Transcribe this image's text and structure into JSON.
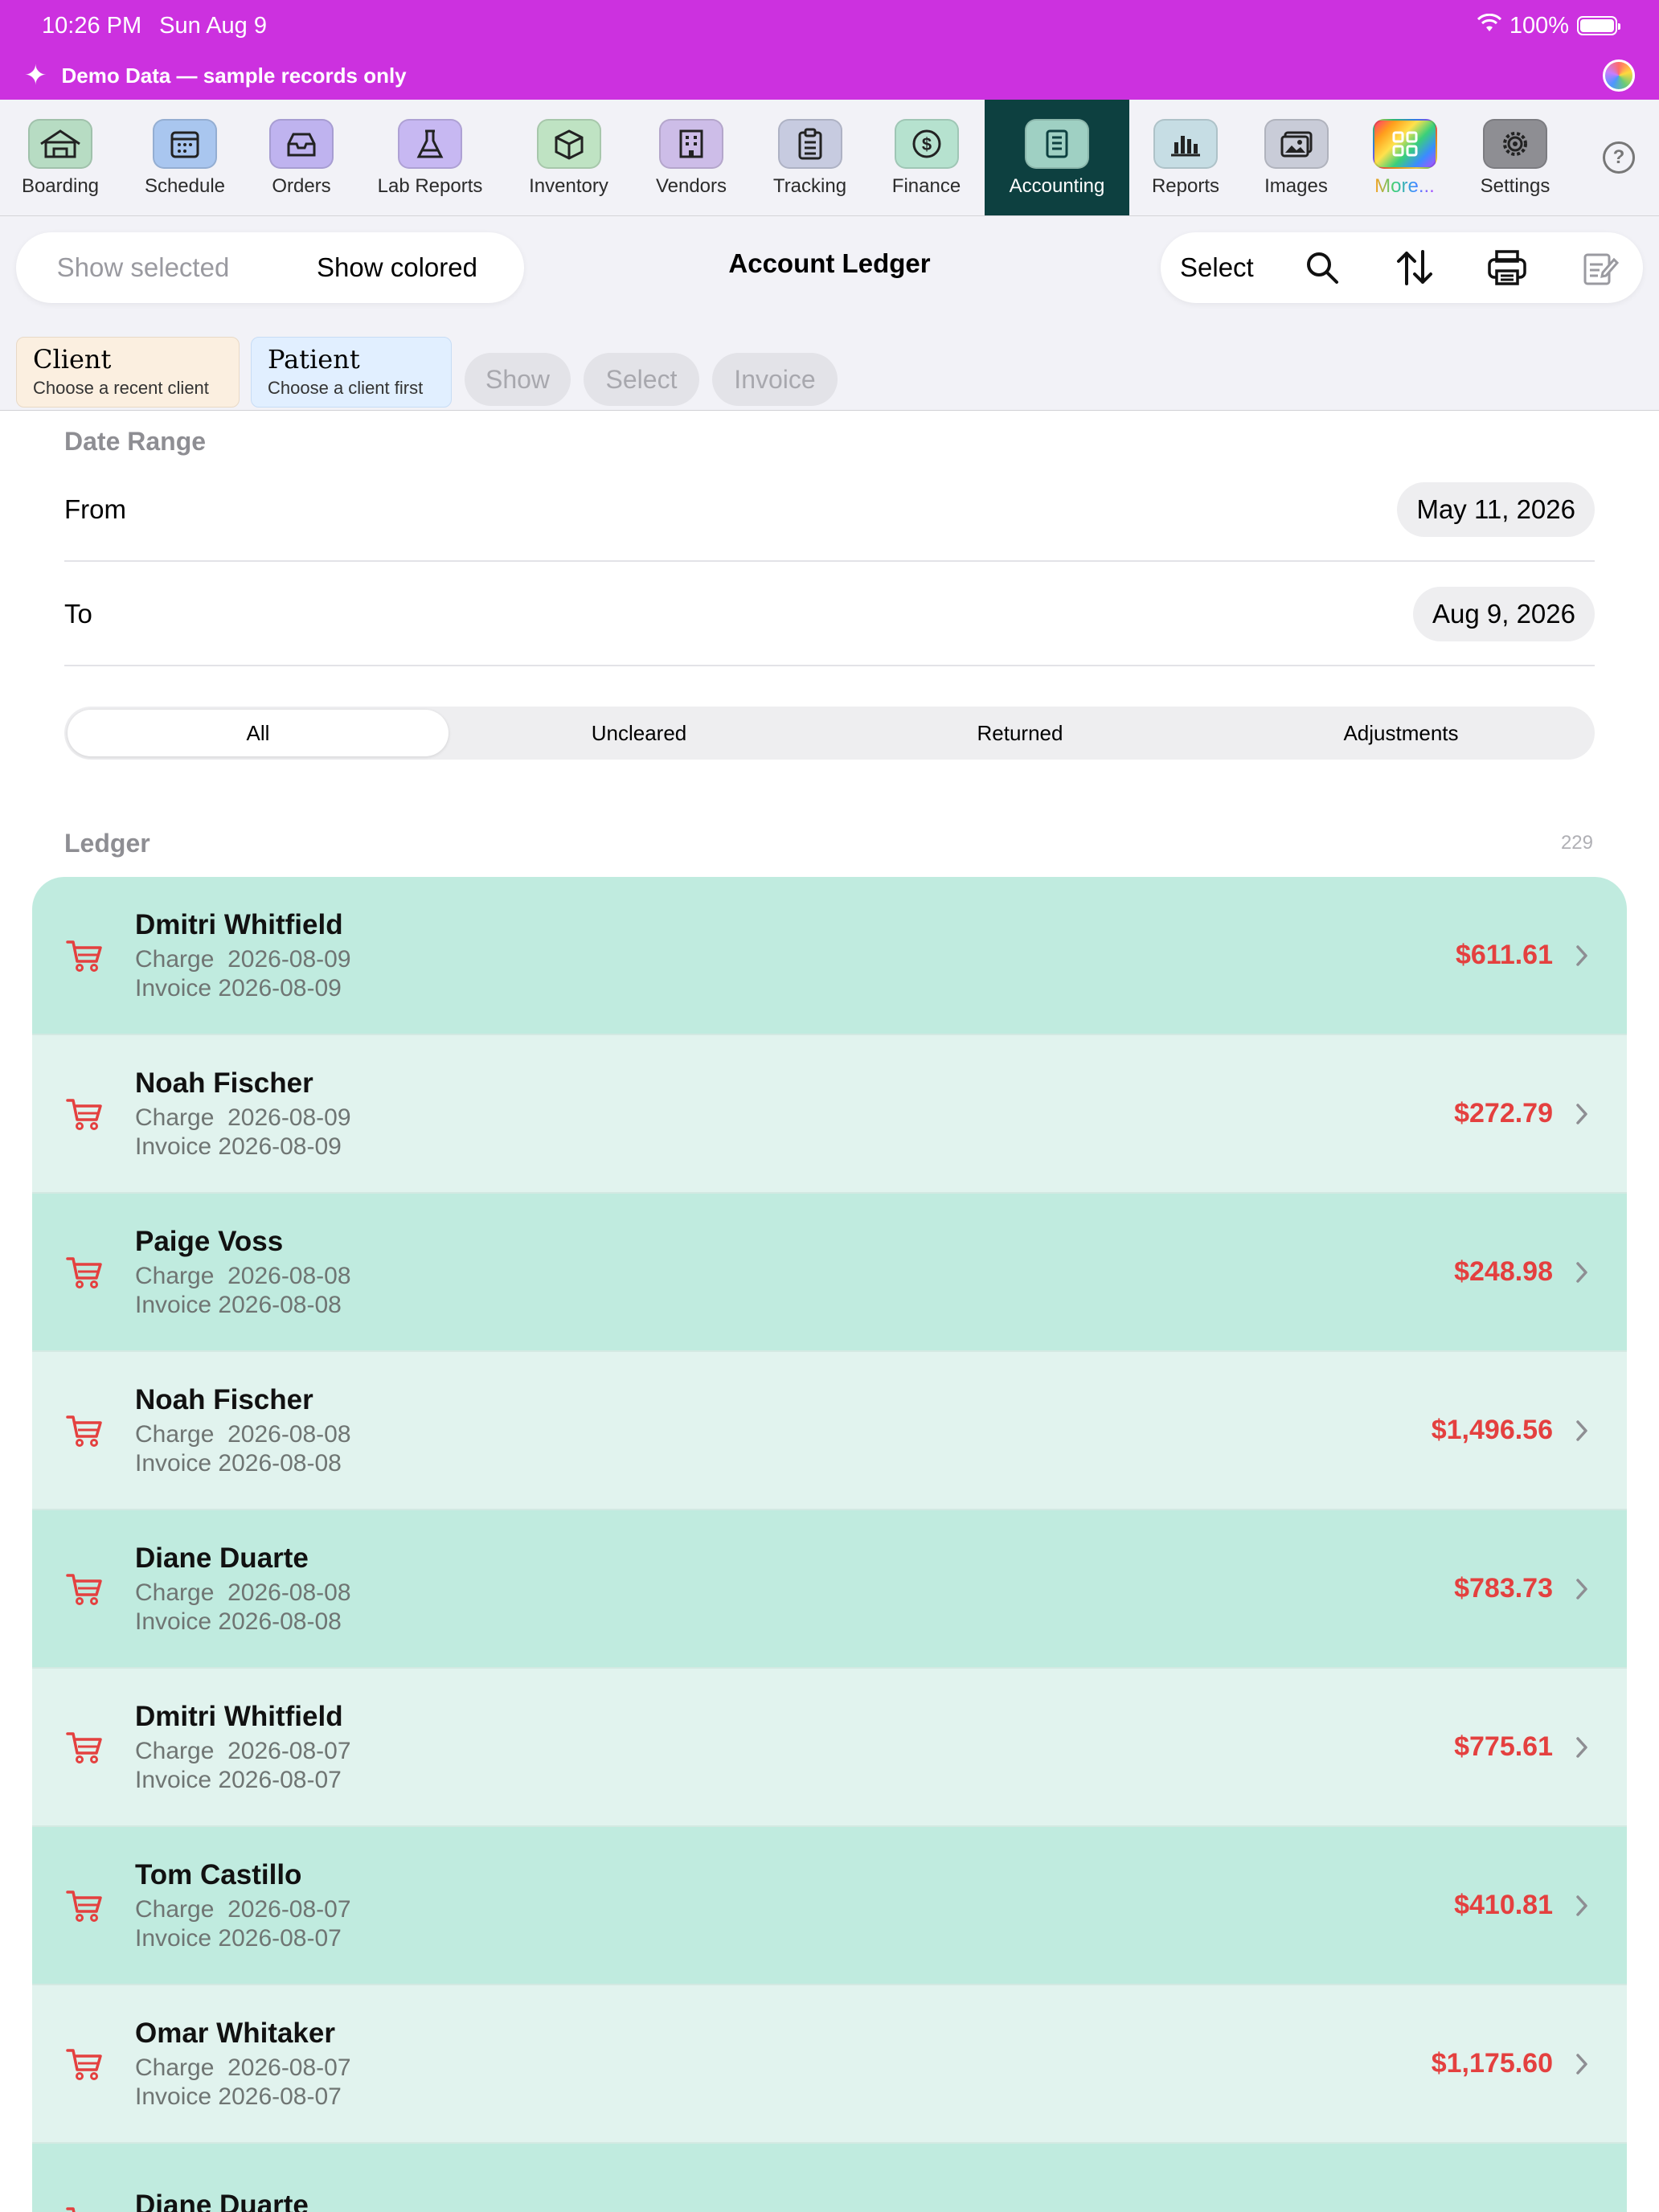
{
  "status": {
    "time": "10:26 PM",
    "date": "Sun Aug 9",
    "battery": "100%"
  },
  "banner": {
    "text": "Demo Data — sample records only"
  },
  "toolbar": {
    "items": [
      {
        "label": "Boarding",
        "icon": "house-icon",
        "color": "#b7dcc3"
      },
      {
        "label": "Schedule",
        "icon": "calendar-icon",
        "color": "#a9c6ef"
      },
      {
        "label": "Orders",
        "icon": "tray-icon",
        "color": "#bfb3ef"
      },
      {
        "label": "Lab Reports",
        "icon": "flask-icon",
        "color": "#c7b8f2"
      },
      {
        "label": "Inventory",
        "icon": "box-icon",
        "color": "#bfe3c3"
      },
      {
        "label": "Vendors",
        "icon": "building-icon",
        "color": "#cdbde8"
      },
      {
        "label": "Tracking",
        "icon": "clipboard-icon",
        "color": "#c7cbe0"
      },
      {
        "label": "Finance",
        "icon": "dollar-icon",
        "color": "#b6e2cf"
      },
      {
        "label": "Accounting",
        "icon": "ledger-icon",
        "color": "#9fd0c3"
      },
      {
        "label": "Reports",
        "icon": "bar-chart-icon",
        "color": "#c6dde4"
      },
      {
        "label": "Images",
        "icon": "photos-icon",
        "color": "#c9ccd8"
      },
      {
        "label": "More...",
        "icon": "grid-icon",
        "color": "rainbow"
      },
      {
        "label": "Settings",
        "icon": "gear-icon",
        "color": "#8e8e93"
      }
    ],
    "active": "Accounting"
  },
  "header": {
    "show_selected": "Show selected",
    "show_colored": "Show colored",
    "title": "Account Ledger",
    "select": "Select"
  },
  "chips": {
    "client": {
      "title": "Client",
      "subtitle": "Choose a recent client"
    },
    "patient": {
      "title": "Patient",
      "subtitle": "Choose a client first"
    }
  },
  "buttons": {
    "show": "Show",
    "select": "Select",
    "invoice": "Invoice"
  },
  "date_range": {
    "label": "Date Range",
    "from_label": "From",
    "from_value": "May 11, 2026",
    "to_label": "To",
    "to_value": "Aug 9, 2026"
  },
  "filters": [
    "All",
    "Uncleared",
    "Returned",
    "Adjustments"
  ],
  "filter_selected": "All",
  "ledger": {
    "label": "Ledger",
    "count": "229",
    "entries": [
      {
        "name": "Dmitri Whitfield",
        "type": "Charge",
        "date": "2026-08-09",
        "invoice": "Invoice 2026-08-09",
        "amount": "$611.61"
      },
      {
        "name": "Noah Fischer",
        "type": "Charge",
        "date": "2026-08-09",
        "invoice": "Invoice 2026-08-09",
        "amount": "$272.79"
      },
      {
        "name": "Paige Voss",
        "type": "Charge",
        "date": "2026-08-08",
        "invoice": "Invoice 2026-08-08",
        "amount": "$248.98"
      },
      {
        "name": "Noah Fischer",
        "type": "Charge",
        "date": "2026-08-08",
        "invoice": "Invoice 2026-08-08",
        "amount": "$1,496.56"
      },
      {
        "name": "Diane Duarte",
        "type": "Charge",
        "date": "2026-08-08",
        "invoice": "Invoice 2026-08-08",
        "amount": "$783.73"
      },
      {
        "name": "Dmitri Whitfield",
        "type": "Charge",
        "date": "2026-08-07",
        "invoice": "Invoice 2026-08-07",
        "amount": "$775.61"
      },
      {
        "name": "Tom Castillo",
        "type": "Charge",
        "date": "2026-08-07",
        "invoice": "Invoice 2026-08-07",
        "amount": "$410.81"
      },
      {
        "name": "Omar Whitaker",
        "type": "Charge",
        "date": "2026-08-07",
        "invoice": "Invoice 2026-08-07",
        "amount": "$1,175.60"
      },
      {
        "name": "Diane Duarte",
        "type": "",
        "date": "",
        "invoice": "",
        "amount": ""
      }
    ]
  },
  "colors": {
    "accent": "#cc31df",
    "active_tab": "#0d4040",
    "row_dark": "#c0ebdf",
    "row_light": "#e1f3ee",
    "amount": "#e4403f"
  }
}
